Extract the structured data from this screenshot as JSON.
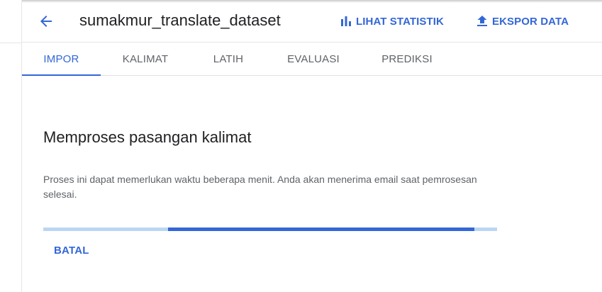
{
  "header": {
    "title": "sumakmur_translate_dataset",
    "actions": {
      "stats_label": "LIHAT STATISTIK",
      "export_label": "EKSPOR DATA"
    }
  },
  "tabs": [
    {
      "label": "IMPOR",
      "active": true
    },
    {
      "label": "KALIMAT",
      "active": false
    },
    {
      "label": "LATIH",
      "active": false
    },
    {
      "label": "EVALUASI",
      "active": false
    },
    {
      "label": "PREDIKSI",
      "active": false
    }
  ],
  "main": {
    "heading": "Memproses pasangan kalimat",
    "description": "Proses ini dapat memerlukan waktu beberapa menit. Anda akan menerima email saat pemrosesan selesai.",
    "progress": {
      "state": "indeterminate"
    },
    "cancel_label": "BATAL"
  },
  "colors": {
    "accent": "#3367d6",
    "progress_track": "#bbd6f4",
    "text_primary": "#202124",
    "text_secondary": "#5f6368"
  },
  "icons": {
    "back": "arrow-back-icon",
    "stats": "bar-chart-icon",
    "export": "upload-icon"
  }
}
